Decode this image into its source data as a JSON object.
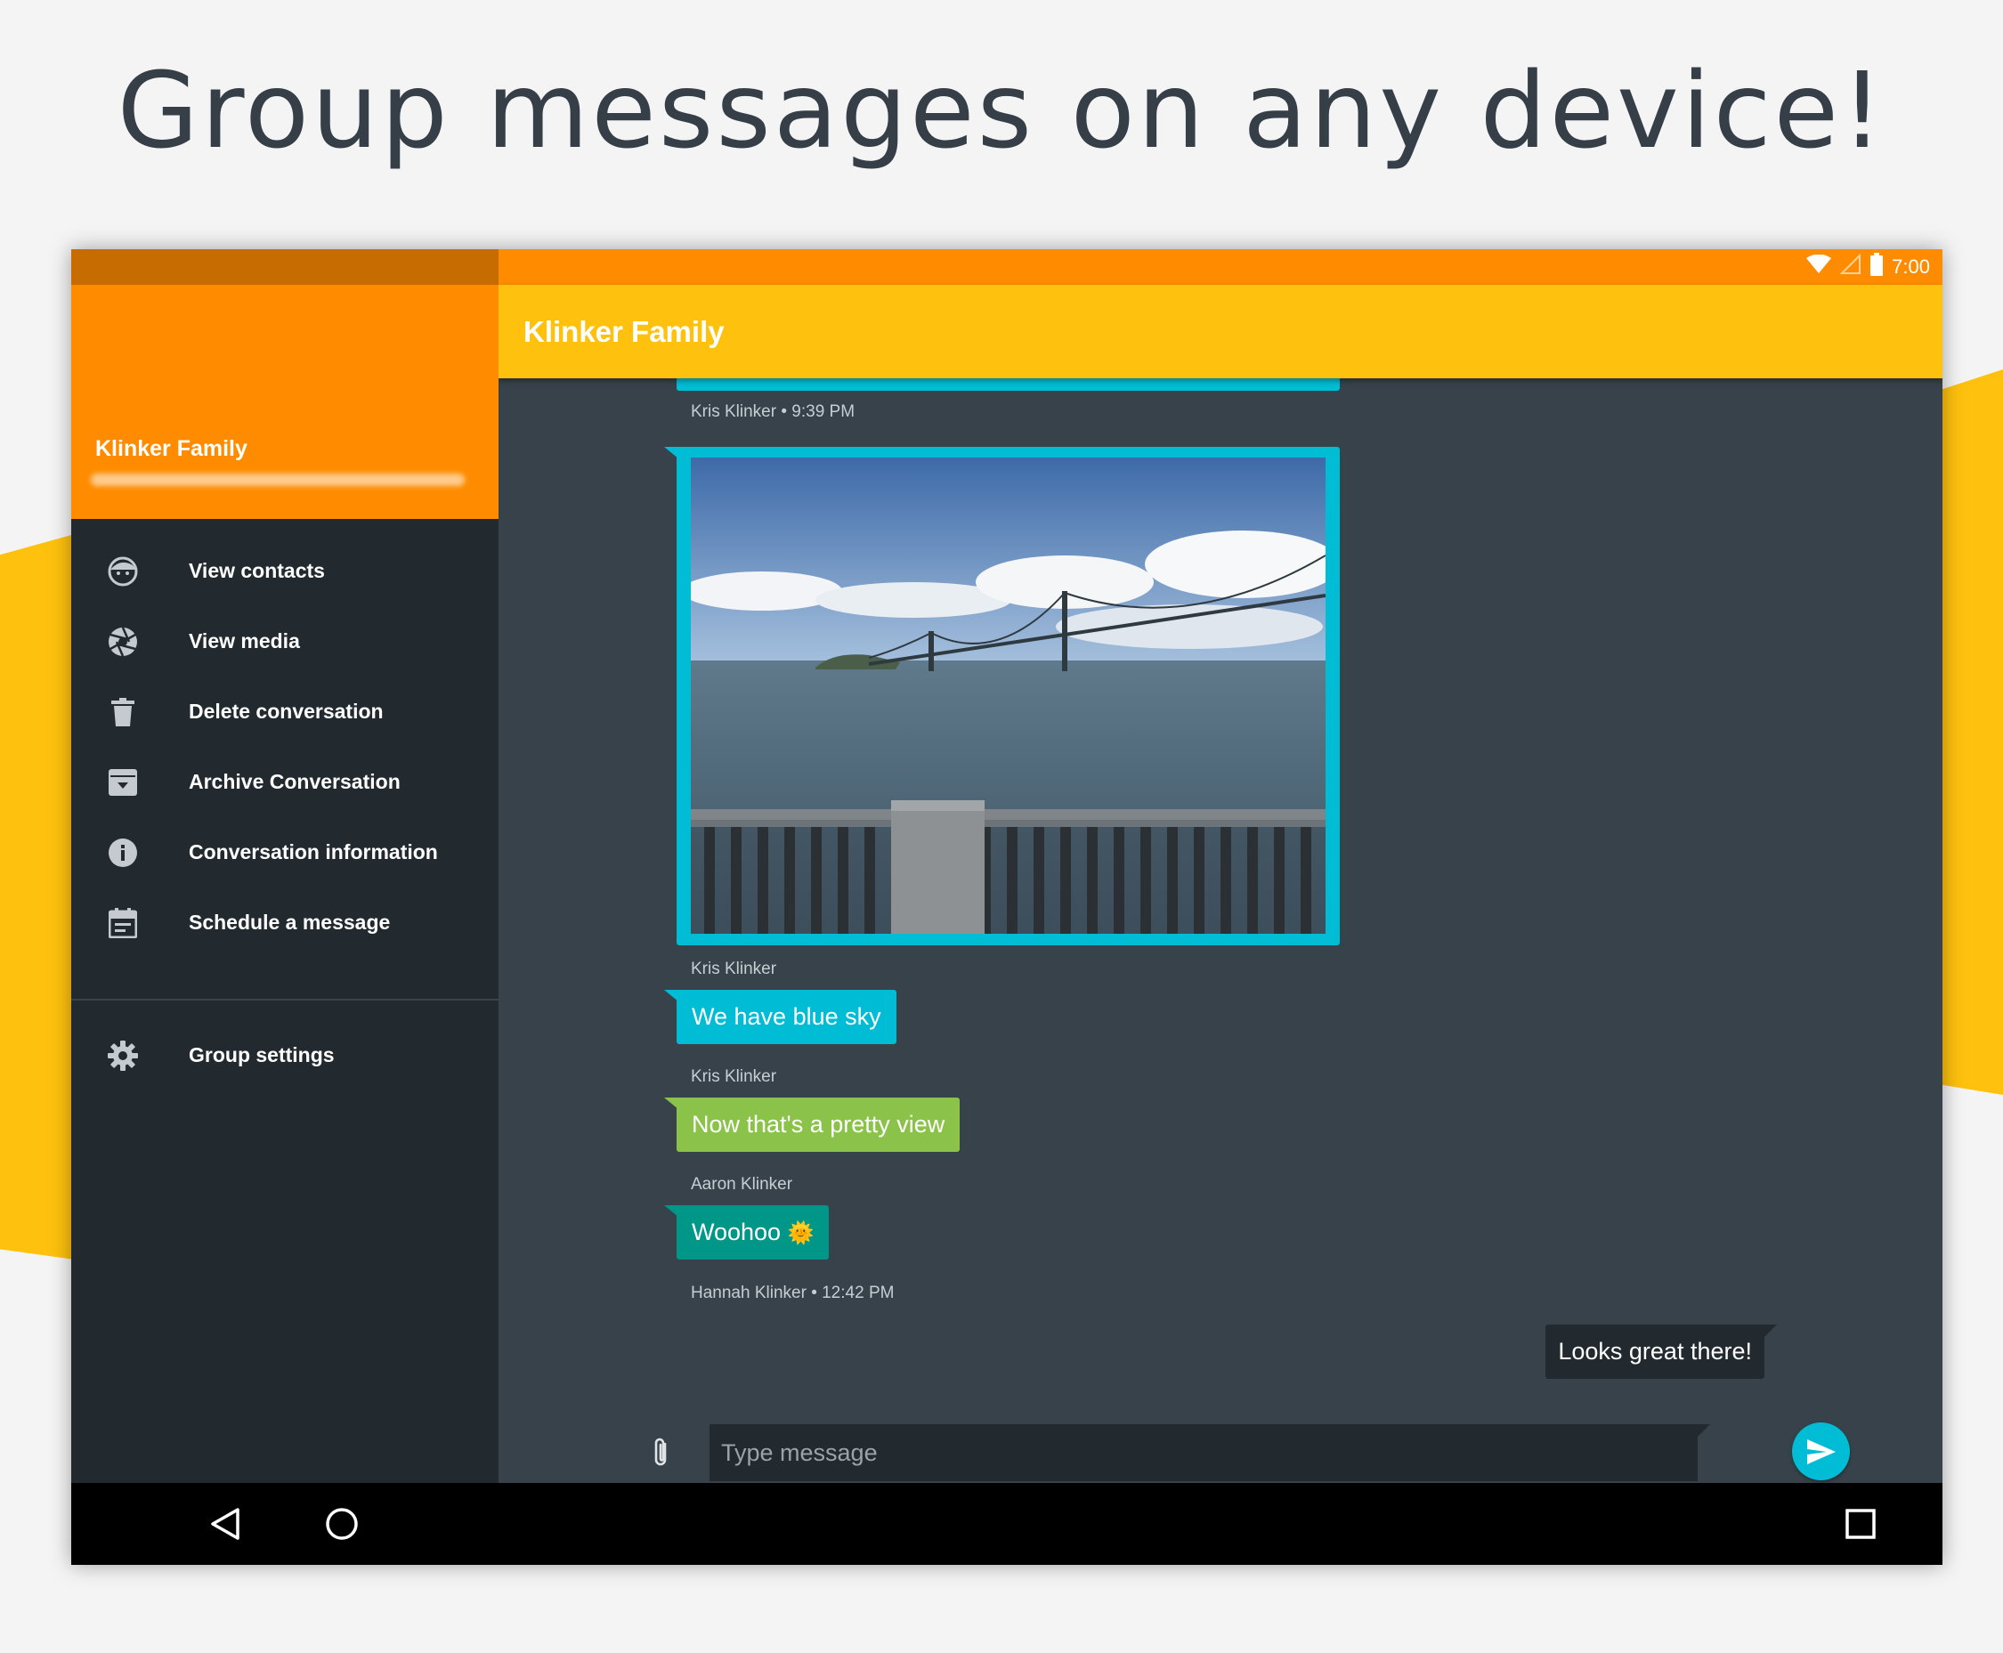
{
  "headline": "Group messages on any device!",
  "colors": {
    "primary": "#fec10e",
    "primary_dark": "#ff8c00",
    "accent": "#00bcd4",
    "bubble_green": "#8bc34a",
    "bubble_teal": "#009688",
    "background": "#37424a",
    "drawer_background": "#222a30"
  },
  "status_bar": {
    "time": "7:00",
    "icons": [
      "wifi-icon",
      "signal-icon",
      "battery-icon"
    ]
  },
  "toolbar": {
    "title": "Klinker Family"
  },
  "drawer": {
    "title": "Klinker Family",
    "items": [
      {
        "label": "View contacts",
        "icon": "face-icon"
      },
      {
        "label": "View media",
        "icon": "camera-aperture-icon"
      },
      {
        "label": "Delete conversation",
        "icon": "trash-icon"
      },
      {
        "label": "Archive Conversation",
        "icon": "archive-icon"
      },
      {
        "label": "Conversation information",
        "icon": "info-icon"
      },
      {
        "label": "Schedule a message",
        "icon": "calendar-icon"
      }
    ],
    "settings": {
      "label": "Group settings",
      "icon": "gear-icon"
    }
  },
  "messages": [
    {
      "type": "text-partial",
      "meta": "Kris Klinker • 9:39 PM"
    },
    {
      "type": "image",
      "meta": "Kris Klinker"
    },
    {
      "type": "text",
      "text": "We have blue sky",
      "meta": "Kris Klinker",
      "color": "#00bcd4"
    },
    {
      "type": "text",
      "text": "Now that's a pretty view",
      "meta": "Aaron Klinker",
      "color": "#8bc34a"
    },
    {
      "type": "text",
      "text": "Woohoo",
      "emoji": "🌞",
      "meta": "Hannah Klinker • 12:42 PM",
      "color": "#009688"
    },
    {
      "type": "outgoing",
      "text": "Looks great there!"
    }
  ],
  "composer": {
    "placeholder": "Type message"
  },
  "nav": {
    "buttons": [
      "back-icon",
      "home-icon",
      "recents-icon"
    ]
  }
}
